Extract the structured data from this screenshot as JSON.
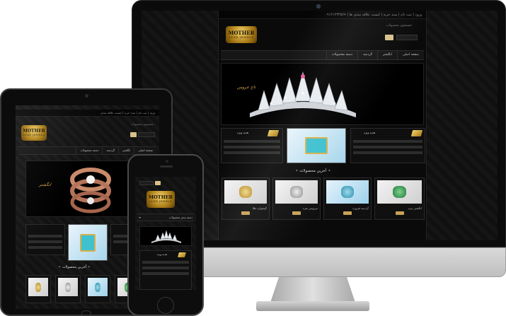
{
  "imac_site": {
    "topbar_text": "ورود | ثبت نام | سبد خرید | لیست علاقه مندی ها | ۰۹۱۲۱۲۳۴۵۶۷",
    "logo_word": "MOTHER",
    "logo_sub": "LUXE JEWELS",
    "search_label": "جستجوی محصولات",
    "nav": [
      "صفحه اصلی",
      "انگشتر",
      "گردنبند",
      "دسته محصولات"
    ],
    "banner_caption": "تاج عروس",
    "section_title": "آخرین محصولات",
    "products": [
      {
        "name": "گوشواره طلا"
      },
      {
        "name": "سرویس نقره"
      },
      {
        "name": "گردنبند فیروزه"
      },
      {
        "name": "انگشتر زمرد"
      }
    ],
    "card_title_left": "هدیه ویژه",
    "card_title_right": "هدیه ویژه"
  },
  "ipad_site": {
    "topbar_text": "ورود | ثبت نام | سبد خرید | لیست علاقه مندی",
    "logo_word": "MOTHER",
    "logo_sub": "LUXE JEWELS",
    "search_label": "جستجوی محصولات",
    "nav": [
      "صفحه اصلی",
      "انگشتر",
      "گردنبند",
      "دسته محصولات"
    ],
    "banner_caption": "انگشتر",
    "section_title": "آخرین محصولات"
  },
  "iphone_site": {
    "logo_word": "MOTHER",
    "logo_sub": "LUXE JEWELS",
    "menu_label": "دسته بندی محصولات",
    "card_title": "هدیه ویژه"
  },
  "colors": {
    "gold": "#d9a64a",
    "background": "#0a0a0a",
    "button": "#c8a257"
  }
}
